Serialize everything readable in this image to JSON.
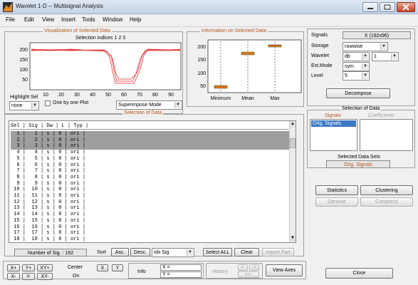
{
  "window": {
    "title": "Wavelet 1-D -- Multisignal Analysis"
  },
  "menu": [
    "File",
    "Edit",
    "View",
    "Insert",
    "Tools",
    "Window",
    "Help"
  ],
  "viz_panel": {
    "title": "Visualization of Selected Data",
    "selection_caption": "Selection indices 1 2 3",
    "y_ticks": [
      "200",
      "150",
      "100",
      "50"
    ],
    "x_ticks": [
      "10",
      "20",
      "30",
      "40",
      "50",
      "60",
      "70",
      "80",
      "90"
    ],
    "highlight_label": "Highlight Sel",
    "highlight_value": "none",
    "one_by_one_label": "One by one Plot",
    "mode_value": "Superimpose Mode"
  },
  "info_panel": {
    "title": "Information on Selected Data",
    "y_ticks": [
      "200",
      "150",
      "100",
      "50"
    ],
    "x_labels": [
      "Minimum",
      "Mean",
      "Max"
    ]
  },
  "selection_panel": {
    "title": "Selection of Data",
    "header": "Sel | Sig | Dw | L | Typ |",
    "rows": [
      "  1 |   1 | s | 0 | ori |",
      "  2 |   2 | s | 0 | ori |",
      "  3 |   3 | s | 0 | ori |",
      "  4 |   4 | s | 0 | ori |",
      "  5 |   5 | s | 0 | ori |",
      "  6 |   6 | s | 0 | ori |",
      "  7 |   7 | s | 0 | ori |",
      "  8 |   8 | s | 0 | ori |",
      "  9 |   9 | s | 0 | ori |",
      " 10 |  10 | s | 0 | ori |",
      " 11 |  11 | s | 0 | ori |",
      " 12 |  12 | s | 0 | ori |",
      " 13 |  13 | s | 0 | ori |",
      " 14 |  14 | s | 0 | ori |",
      " 15 |  15 | s | 0 | ori |",
      " 16 |  16 | s | 0 | ori |",
      " 17 |  17 | s | 0 | ori |",
      " 18 |  18 | s | 0 | ori |"
    ],
    "selected_rows": [
      0,
      1,
      2
    ],
    "num_sig_label": "Number of Sig. : 192",
    "sort_label": "Sort",
    "asc_label": "Asc.",
    "desc_label": "Desc.",
    "sort_key_value": "Idx Sig",
    "select_all_label": "Select ALL",
    "clear_label": "Clear",
    "import_part_label": "Import Part"
  },
  "settings": {
    "signals_label": "Signals",
    "signals_value": "X (192x96)",
    "storage_label": "Storage",
    "storage_value": "rowwise",
    "wavelet_label": "Wavelet",
    "wavelet_family": "db",
    "wavelet_order": "1",
    "extmode_label": "Ext.Mode",
    "extmode_value": "sym",
    "level_label": "Level",
    "level_value": "5",
    "decompose_label": "Decompose"
  },
  "sel_data_panel": {
    "title": "Selection of Data",
    "signals_tab": "Signals",
    "coefficients_tab": "Coefficients",
    "signals_item": "Orig. Signals",
    "selected_sets_label": "Selected Data Sets",
    "selected_sets_value": "Orig. Signals"
  },
  "actions": {
    "statistics": "Statistics",
    "clustering": "Clustering",
    "denoise": "Denoise",
    "compress": "Compress",
    "close": "Close"
  },
  "bottom": {
    "xplus": "X+",
    "yplus": "Y+",
    "xyplus": "XY+",
    "xminus": "X-",
    "yminus": "Y-",
    "xyminus": "XY-",
    "center_label": "Center",
    "center_on": "On",
    "x_btn": "X",
    "y_btn": "Y",
    "info_label": "Info",
    "x_eq": "X =",
    "y_eq": "Y =",
    "history_label": "History",
    "hist_back": "<-",
    "hist_fwd": "->",
    "hist_reset": "<<-",
    "view_axes": "View Axes"
  }
}
